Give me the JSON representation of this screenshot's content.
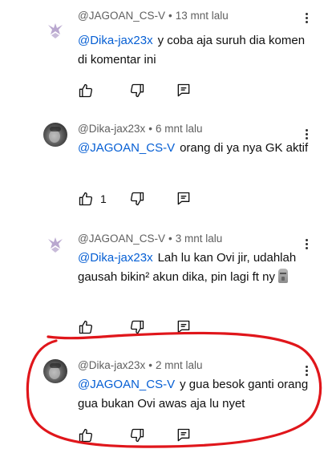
{
  "comments": [
    {
      "author": "@JAGOAN_CS-V",
      "time": "13 mnt lalu",
      "mention": "@Dika-jax23x",
      "text": "y coba aja suruh dia komen di komentar ini",
      "like_count": "",
      "avatar_icon": "crest-logo-icon"
    },
    {
      "author": "@Dika-jax23x",
      "time": "6 mnt lalu",
      "mention": "@JAGOAN_CS-V",
      "text": "orang di ya nya GK aktif",
      "like_count": "1",
      "avatar_icon": "user-photo-icon"
    },
    {
      "author": "@JAGOAN_CS-V",
      "time": "3 mnt lalu",
      "mention": "@Dika-jax23x",
      "text": "Lah lu kan Ovi jir, udahlah gausah bikin² akun dika, pin lagi ft ny",
      "emoji": "moai-emoji-icon",
      "like_count": "",
      "avatar_icon": "crest-logo-icon"
    },
    {
      "author": "@Dika-jax23x",
      "time": "2 mnt lalu",
      "mention": "@JAGOAN_CS-V",
      "text": "y gua besok ganti orang gua bukan Ovi awas aja lu nyet",
      "like_count": "",
      "avatar_icon": "user-photo-icon"
    }
  ],
  "separator": "•",
  "colors": {
    "mention": "#065fd4",
    "meta": "#606060",
    "annotation": "#e0161b"
  },
  "icons": [
    "like-icon",
    "dislike-icon",
    "reply-icon",
    "more-options-icon"
  ]
}
